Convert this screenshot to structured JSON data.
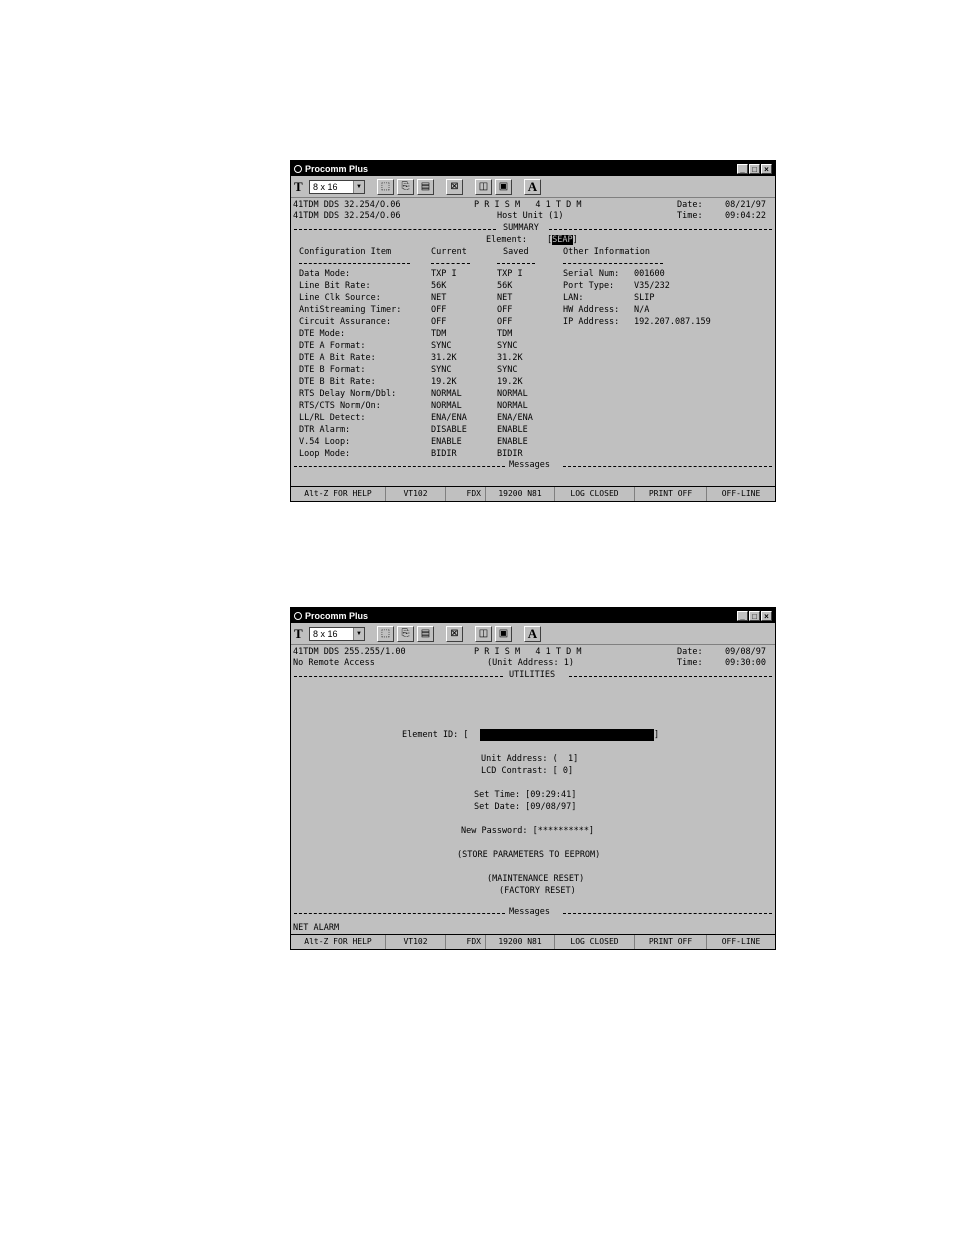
{
  "window_title": "Procomm Plus",
  "window_buttons": [
    "_",
    "□",
    "×"
  ],
  "toolbar": {
    "font_icon": "T",
    "font_size": "8 x 16",
    "bold_a": "A"
  },
  "status_bar": [
    "Alt-Z FOR HELP",
    "VT102",
    "FDX",
    "19200 N81",
    "LOG CLOSED",
    "PRINT OFF",
    "OFF-LINE"
  ],
  "summary": {
    "line1_left": "41TDM DDS 32.254/O.06",
    "line1_center": "P R I S M   4 1 T D M",
    "date_label": "Date:",
    "date_value": "08/21/97",
    "line2_left": "41TDM DDS 32.254/O.06",
    "line2_center": "Host Unit (1)",
    "time_label": "Time:",
    "time_value": "09:04:22",
    "section_title": "SUMMARY",
    "element_label": "Element:",
    "element_value": "SEAP",
    "headers": [
      "Configuration Item",
      "Current",
      "Saved",
      "Other Information"
    ],
    "rows": [
      [
        "Data Mode:",
        "TXP I",
        "TXP I"
      ],
      [
        "Line Bit Rate:",
        "56K",
        "56K"
      ],
      [
        "Line Clk Source:",
        "NET",
        "NET"
      ],
      [
        "AntiStreaming Timer:",
        "OFF",
        "OFF"
      ],
      [
        "Circuit Assurance:",
        "OFF",
        "OFF"
      ],
      [
        "DTE Mode:",
        "TDM",
        "TDM"
      ],
      [
        "DTE A Format:",
        "SYNC",
        "SYNC"
      ],
      [
        "DTE A Bit Rate:",
        "31.2K",
        "31.2K"
      ],
      [
        "DTE B Format:",
        "SYNC",
        "SYNC"
      ],
      [
        "DTE B Bit Rate:",
        "19.2K",
        "19.2K"
      ],
      [
        "RTS Delay Norm/Dbl:",
        "NORMAL",
        "NORMAL"
      ],
      [
        "RTS/CTS Norm/On:",
        "NORMAL",
        "NORMAL"
      ],
      [
        "LL/RL Detect:",
        "ENA/ENA",
        "ENA/ENA"
      ],
      [
        "DTR Alarm:",
        "DISABLE",
        "ENABLE"
      ],
      [
        "V.54 Loop:",
        "ENABLE",
        "ENABLE"
      ],
      [
        "Loop Mode:",
        "BIDIR",
        "BIDIR"
      ]
    ],
    "other_info": [
      [
        "Serial Num:",
        "001600"
      ],
      [
        "Port Type:",
        "V35/232"
      ],
      [
        "LAN:",
        "SLIP"
      ],
      [
        "HW Address:",
        "N/A"
      ],
      [
        "IP Address:",
        "192.207.087.159"
      ]
    ],
    "messages_title": "Messages"
  },
  "utilities": {
    "line1_left": "41TDM DDS 255.255/1.00",
    "line1_center": "P R I S M   4 1 T D M",
    "date_label": "Date:",
    "date_value": "09/08/97",
    "line2_left": "No Remote Access",
    "line2_center": "(Unit Address: 1)",
    "time_label": "Time:",
    "time_value": "09:30:00",
    "section_title": "UTILITIES",
    "element_id_label": "Element ID: [",
    "element_id_close": "]",
    "unit_address": "Unit Address: (  1]",
    "lcd_contrast": "LCD Contrast: [ 0]",
    "set_time": "Set Time: [09:29:41]",
    "set_date": "Set Date: [09/08/97]",
    "new_password": "New Password: [**********]",
    "store_parameters": "(STORE PARAMETERS TO EEPROM)",
    "maintenance_reset": "(MAINTENANCE RESET)",
    "factory_reset": "(FACTORY RESET)",
    "messages_title": "Messages",
    "message_text": "NET ALARM"
  }
}
